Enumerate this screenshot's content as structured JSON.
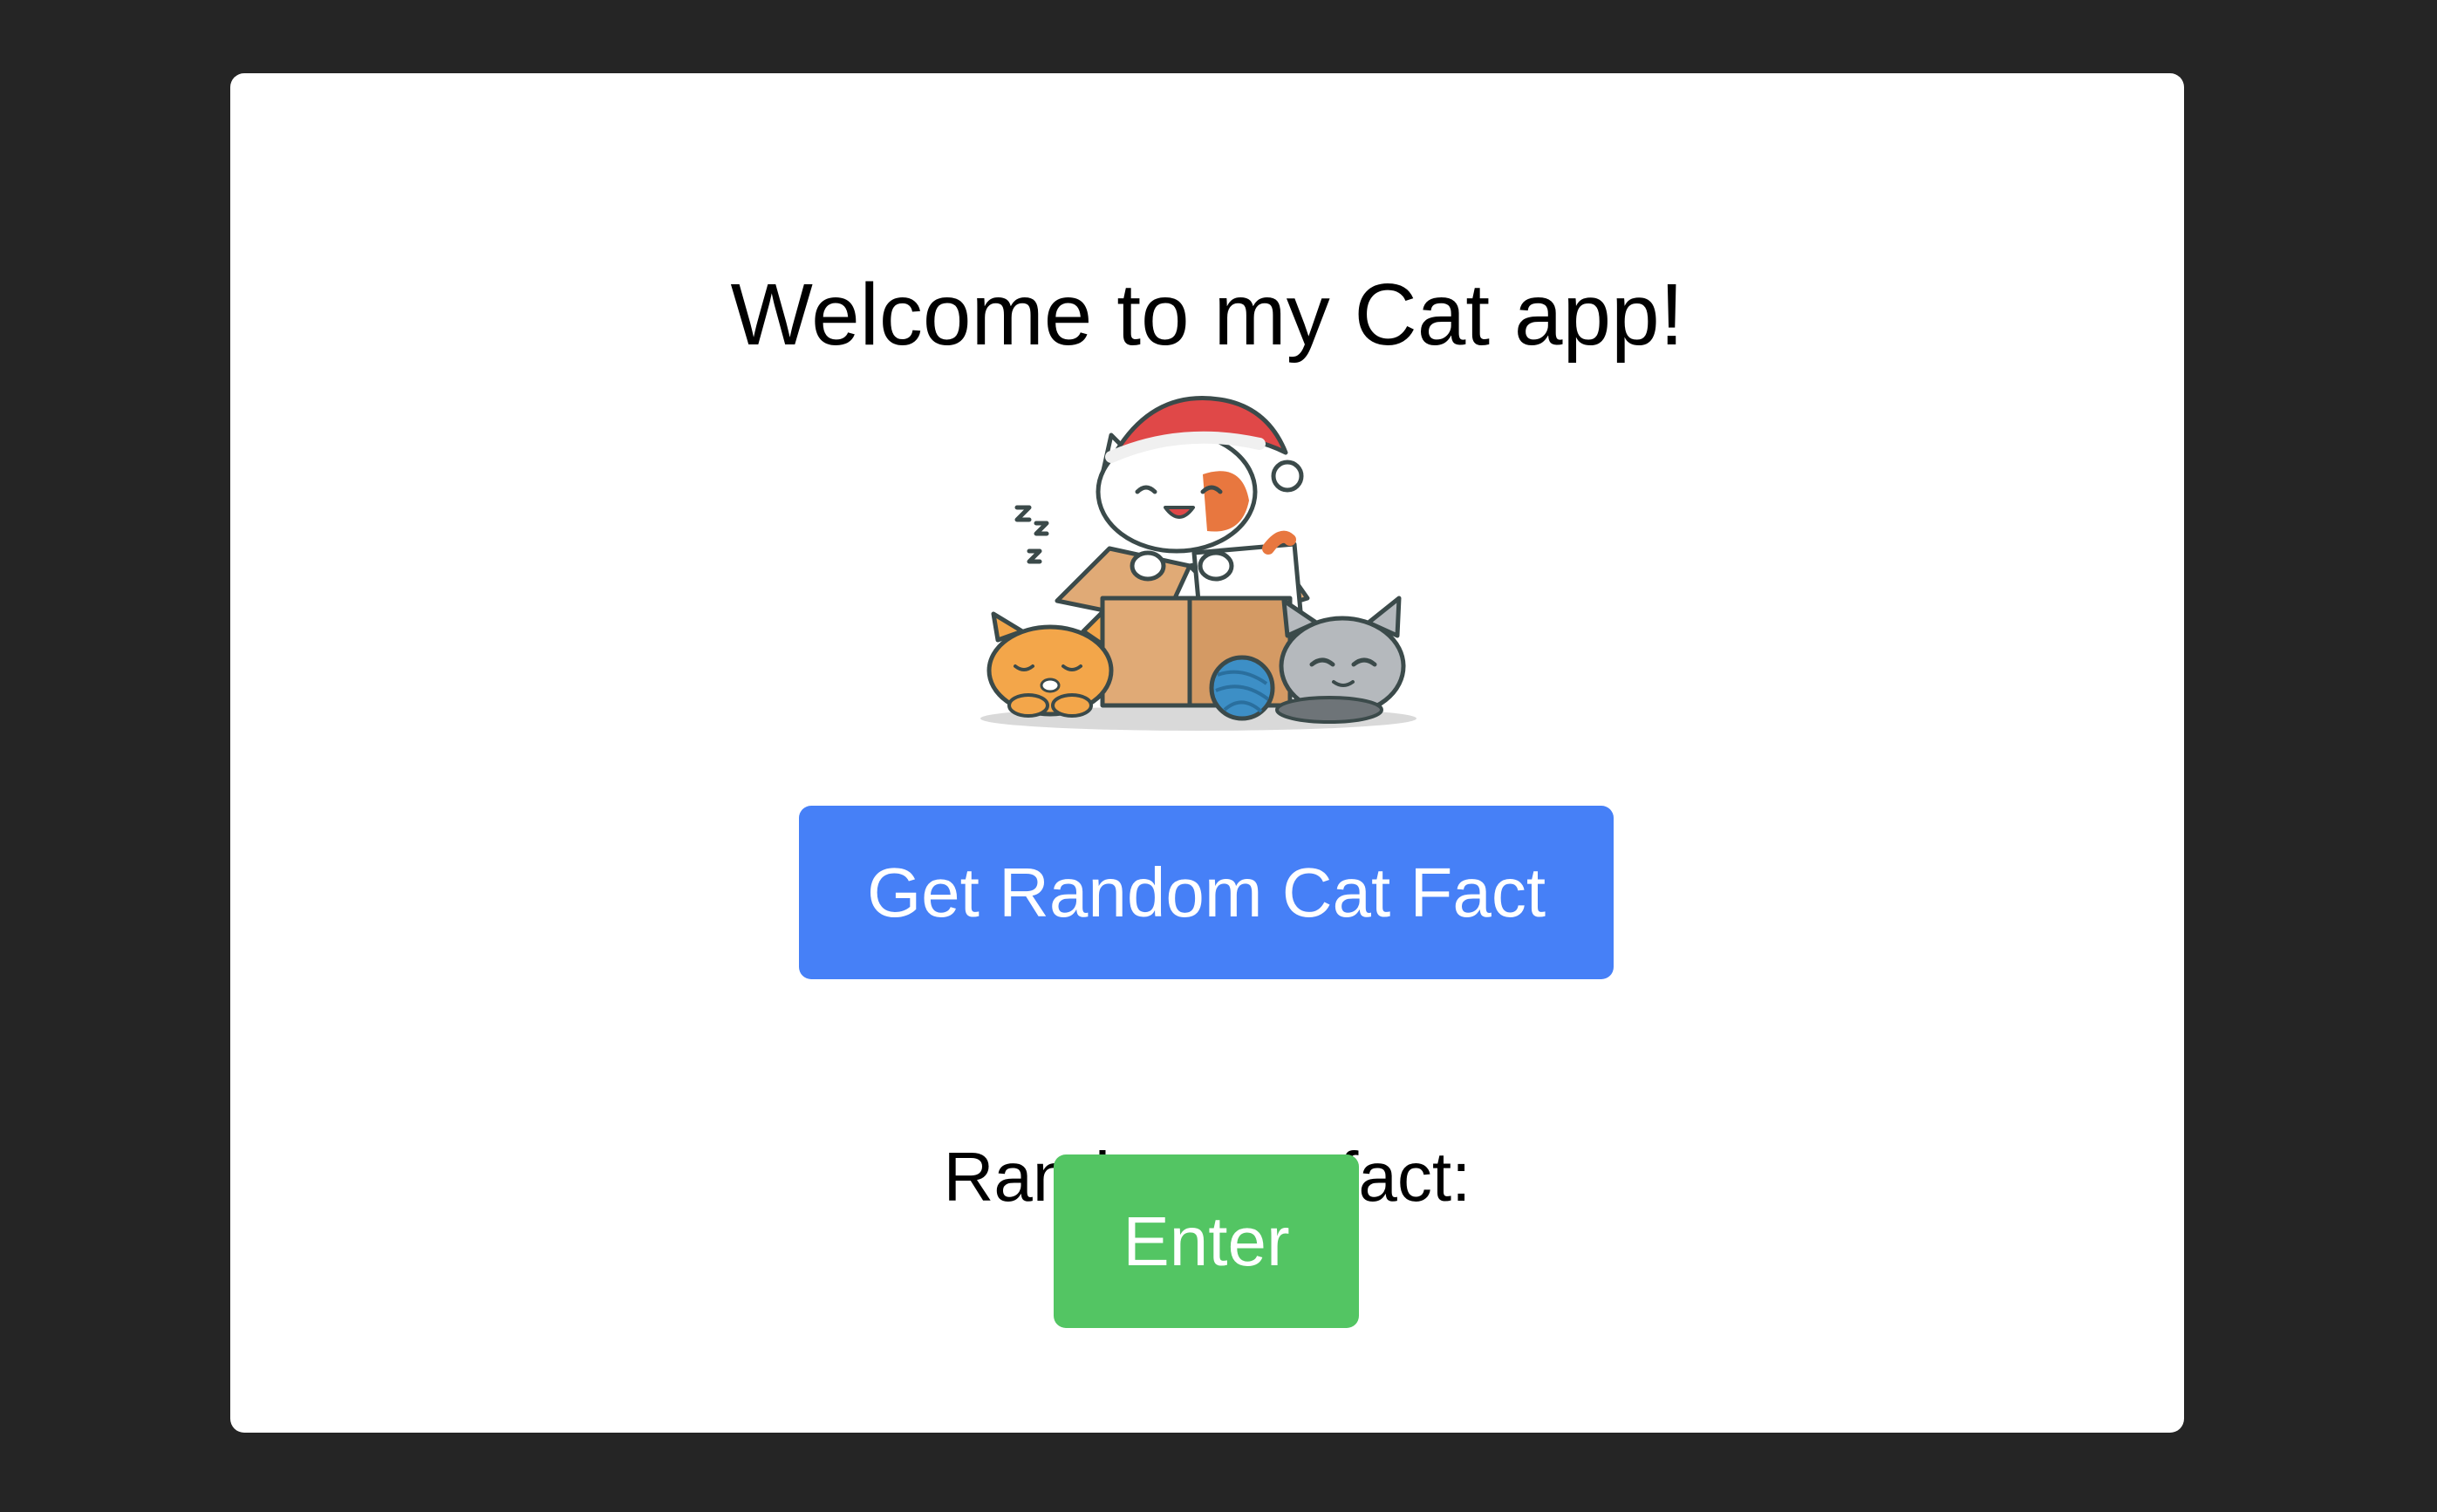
{
  "app": {
    "title": "Welcome to my Cat app!",
    "illustration_alt": "Cartoon cats with a box, yarn ball and Santa hat",
    "fact_button_label": "Get Random Cat Fact",
    "fact_label": "Random cat fact:",
    "enter_button_label": "Enter"
  },
  "colors": {
    "background": "#252525",
    "card": "#ffffff",
    "fact_button": "#4680f7",
    "enter_button": "#53c563"
  }
}
